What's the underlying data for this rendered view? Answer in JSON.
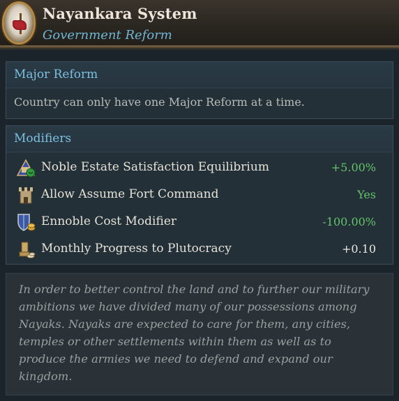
{
  "header": {
    "title": "Nayankara System",
    "subtitle": "Government Reform",
    "emblem_icon": "reform-banner-emblem-icon"
  },
  "major_reform": {
    "heading": "Major Reform",
    "text": "Country can only have one Major Reform at a time."
  },
  "modifiers": {
    "heading": "Modifiers",
    "items": [
      {
        "label": "Noble Estate Satisfaction Equilibrium",
        "value": "+5.00%",
        "icon": "nobility-estate-icon",
        "tone": "positive"
      },
      {
        "label": "Allow Assume Fort Command",
        "value": "Yes",
        "icon": "fort-tower-icon",
        "tone": "positive"
      },
      {
        "label": "Ennoble Cost Modifier",
        "value": "-100.00%",
        "icon": "shield-gold-icon",
        "tone": "positive"
      },
      {
        "label": "Monthly Progress to Plutocracy",
        "value": "+0.10",
        "icon": "plutocracy-coins-icon",
        "tone": "neutral"
      }
    ]
  },
  "description": {
    "text": "In order to better control the land and to further our military ambitions we have divided many of our possessions among Nayaks. Nayaks are expected to care for them, any cities, temples or other settlements within them as well as to produce the armies we need to defend and expand our kingdom."
  },
  "colors": {
    "accent_blue": "#7cc0e0",
    "positive_green": "#63c46a",
    "gold_border": "#b48b46"
  }
}
